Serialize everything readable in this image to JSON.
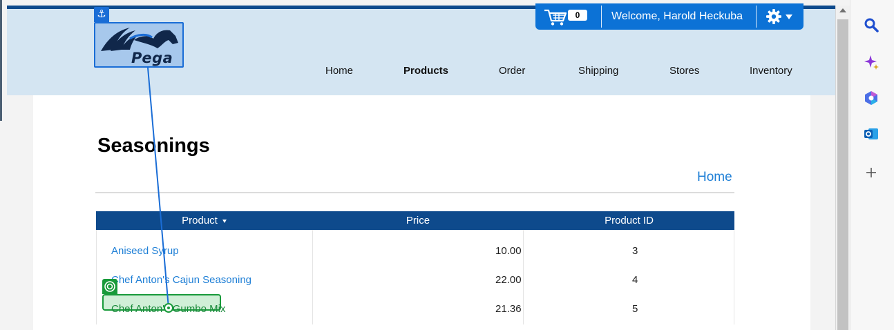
{
  "brand": {
    "logo_text": "Pega",
    "anchor_glyph": "⚓"
  },
  "topbar": {
    "cart_count": "0",
    "welcome": "Welcome, Harold Heckuba"
  },
  "nav": [
    {
      "label": "Home",
      "active": false
    },
    {
      "label": "Products",
      "active": true
    },
    {
      "label": "Order",
      "active": false
    },
    {
      "label": "Shipping",
      "active": false
    },
    {
      "label": "Stores",
      "active": false
    },
    {
      "label": "Inventory",
      "active": false
    }
  ],
  "page": {
    "title": "Seasonings",
    "home_link": "Home"
  },
  "table": {
    "columns": [
      "Product",
      "Price",
      "Product ID"
    ],
    "rows": [
      {
        "product": "Aniseed Syrup",
        "price": "10.00",
        "id": "3"
      },
      {
        "product": "Chef Anton's Cajun Seasoning",
        "price": "22.00",
        "id": "4"
      },
      {
        "product": "Chef Anton's Gumbo Mix",
        "price": "21.36",
        "id": "5"
      }
    ]
  },
  "icons": {
    "cart": "shopping-cart-icon",
    "settings": "gear-icon",
    "sidebar": [
      "search-icon",
      "copilot-sparkle-icon",
      "office-icon",
      "outlook-icon",
      "plus-icon"
    ]
  },
  "colors": {
    "header_bg": "#d4e5f2",
    "topbar_bg": "#0c72d6",
    "table_header": "#0e4a8c",
    "link": "#1e7fd6",
    "highlight": "#189a3a",
    "anchor": "#1a6dd6"
  }
}
